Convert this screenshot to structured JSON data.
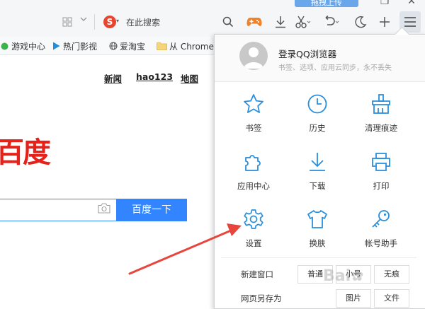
{
  "topbar": {
    "upload_label": "拖拽上传",
    "search_engine_letter": "S",
    "search_placeholder": "在此搜索",
    "icons": [
      "grid-icon",
      "chevron-down-icon",
      "search-icon",
      "gamepad-icon",
      "download-icon",
      "scissors-icon",
      "undo-icon",
      "moon-icon",
      "plus-icon",
      "menu-icon"
    ]
  },
  "bookmarks": [
    {
      "label": "游戏中心",
      "icon": "game-center-icon"
    },
    {
      "label": "热门影视",
      "icon": "play-icon"
    },
    {
      "label": "爱淘宝",
      "icon": "globe-icon"
    },
    {
      "label": "从 Chrome",
      "icon": "folder-icon"
    }
  ],
  "page": {
    "nav_links": [
      "新闻",
      "hao123",
      "地图"
    ],
    "logo_text": "百度",
    "search_button": "百度一下"
  },
  "menu": {
    "login_title": "登录QQ浏览器",
    "login_subtitle": "书签、选项、应用云同步，永不丢失",
    "grid": [
      {
        "label": "书签",
        "icon": "star-icon"
      },
      {
        "label": "历史",
        "icon": "clock-icon"
      },
      {
        "label": "清理痕迹",
        "icon": "broom-icon"
      },
      {
        "label": "应用中心",
        "icon": "puzzle-icon"
      },
      {
        "label": "下载",
        "icon": "download-icon"
      },
      {
        "label": "打印",
        "icon": "printer-icon"
      },
      {
        "label": "设置",
        "icon": "gear-icon"
      },
      {
        "label": "换肤",
        "icon": "shirt-icon"
      },
      {
        "label": "帐号助手",
        "icon": "key-icon"
      }
    ],
    "new_window": {
      "label": "新建窗口",
      "options": [
        "普通",
        "小号",
        "无痕"
      ]
    },
    "save_page": {
      "label": "网页另存为",
      "options": [
        "图片",
        "文件"
      ]
    }
  },
  "colors": {
    "accent": "#3385ff",
    "menu_icon": "#2a8fdc",
    "baidu_red": "#e6211a",
    "annotation_arrow": "#e8453c"
  }
}
